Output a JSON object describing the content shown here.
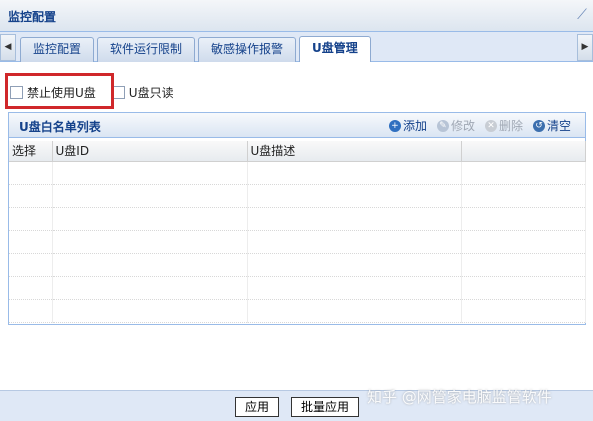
{
  "window": {
    "title": "监控配置"
  },
  "tabs": [
    {
      "label": "监控配置",
      "active": false
    },
    {
      "label": "软件运行限制",
      "active": false
    },
    {
      "label": "敏感操作报警",
      "active": false
    },
    {
      "label": "U盘管理",
      "active": true
    }
  ],
  "options": {
    "disable_usb_label": "禁止使用U盘",
    "usb_readonly_label": "U盘只读",
    "disable_usb_checked": false,
    "usb_readonly_checked": false
  },
  "whitelist": {
    "title": "U盘白名单列表",
    "tools": {
      "add": "添加",
      "edit": "修改",
      "delete": "删除",
      "clear": "清空"
    },
    "columns": [
      "选择",
      "U盘ID",
      "U盘描述",
      ""
    ],
    "rows": []
  },
  "footer": {
    "apply_label": "应用",
    "batch_apply_label": "批量应用"
  },
  "watermark": "知乎 @网管家电脑监管软件",
  "colors": {
    "highlight": "#d0282a",
    "accent": "#15428b"
  }
}
